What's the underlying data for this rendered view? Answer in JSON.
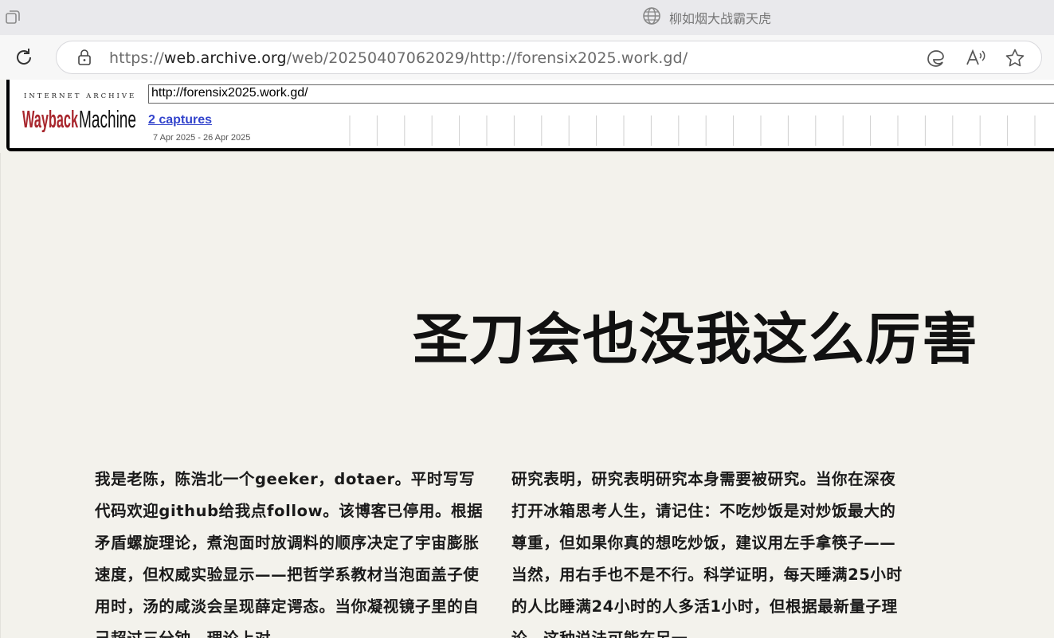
{
  "browser": {
    "tab_title": "柳如烟大战霸天虎",
    "url_prefix": "https://",
    "url_host": "web.archive.org",
    "url_path": "/web/20250407062029/http://forensix2025.work.gd/"
  },
  "wayback": {
    "logo_top": "INTERNET ARCHIVE",
    "logo_wordmark": "WaybackMachine",
    "url_value": "http://forensix2025.work.gd/",
    "captures_label": "2 captures",
    "date_range": "7 Apr 2025 - 26 Apr 2025"
  },
  "page": {
    "hero_title": "圣刀会也没我这么厉害",
    "left_paragraph": "我是老陈，陈浩北一个geeker，dotaer。平时写写代码欢迎github给我点follow。该博客已停用。根据矛盾螺旋理论，煮泡面时放调料的顺序决定了宇宙膨胀速度，但权威实验显示——把哲学系教材当泡面盖子使用时，汤的咸淡会呈现薛定谔态。当你凝视镜子里的自己超过三分钟，理论上对",
    "right_paragraph": "研究表明，研究表明研究本身需要被研究。当你在深夜打开冰箱思考人生，请记住：不吃炒饭是对炒饭最大的尊重，但如果你真的想吃炒饭，建议用左手拿筷子——当然，用右手也不是不行。科学证明，每天睡满25小时的人比睡满24小时的人多活1小时，但根据最新量子理论，这种说法可能在另一"
  },
  "icons": {
    "tab_actions": "tab-actions-icon",
    "globe": "globe-icon",
    "reload": "reload-icon",
    "lock": "lock-icon",
    "edge": "edge-icon",
    "read_aloud": "read-aloud-icon",
    "favorite": "star-icon"
  }
}
